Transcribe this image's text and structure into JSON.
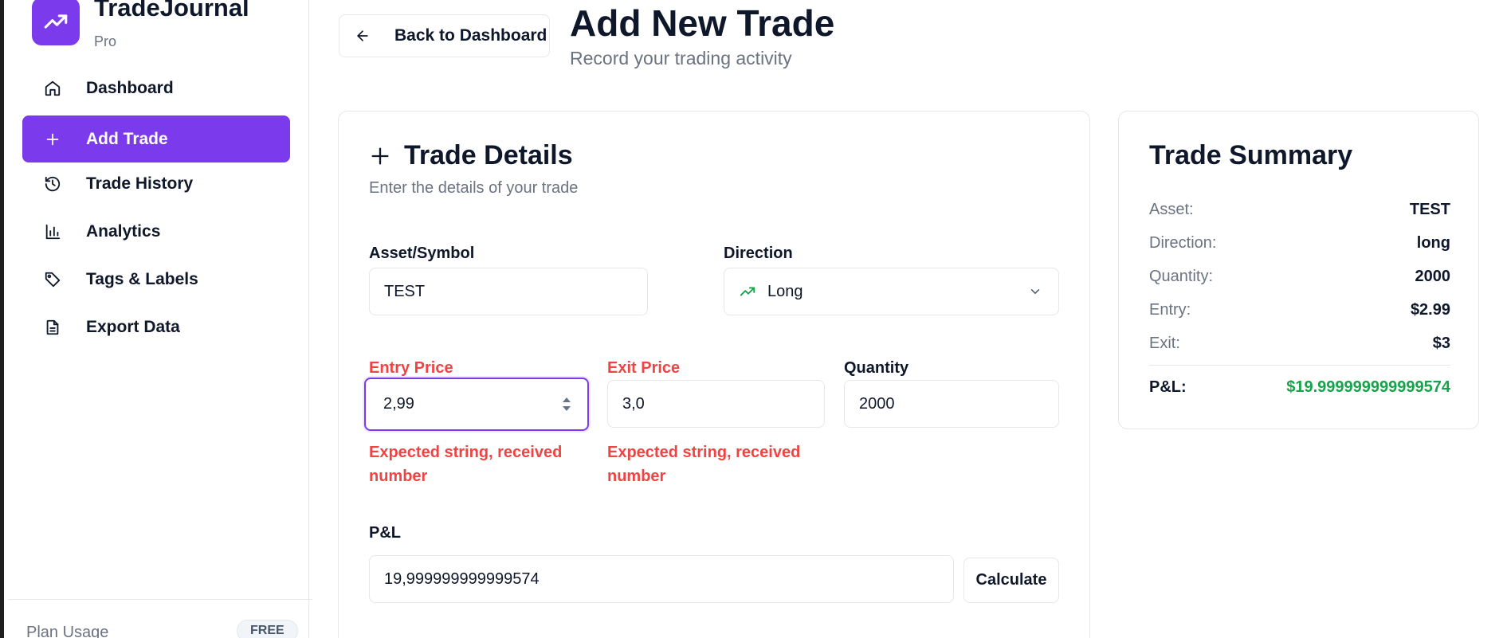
{
  "sidebar": {
    "brand_name": "TradeJournal",
    "brand_plan": "Pro",
    "items": [
      {
        "label": "Dashboard",
        "icon": "home-icon"
      },
      {
        "label": "Add Trade",
        "icon": "plus-icon"
      },
      {
        "label": "Trade History",
        "icon": "history-icon"
      },
      {
        "label": "Analytics",
        "icon": "bar-chart-icon"
      },
      {
        "label": "Tags & Labels",
        "icon": "tag-icon"
      },
      {
        "label": "Export Data",
        "icon": "file-icon"
      }
    ],
    "active_item": "Add Trade",
    "plan_usage_label": "Plan Usage",
    "plan_badge": "FREE"
  },
  "header": {
    "back_label": "Back to Dashboard",
    "title": "Add New Trade",
    "subtitle": "Record your trading activity"
  },
  "details": {
    "title": "Trade Details",
    "subtitle": "Enter the details of your trade",
    "asset_label": "Asset/Symbol",
    "asset_value": "TEST",
    "direction_label": "Direction",
    "direction_value": "Long",
    "entry_label": "Entry Price",
    "entry_value": "2,99",
    "entry_error": "Expected string, received number",
    "exit_label": "Exit Price",
    "exit_value": "3,0",
    "exit_error": "Expected string, received number",
    "quantity_label": "Quantity",
    "quantity_value": "2000",
    "pl_label": "P&L",
    "pl_value": "19,999999999999574",
    "calculate_label": "Calculate"
  },
  "summary": {
    "title": "Trade Summary",
    "asset_key": "Asset:",
    "asset_val": "TEST",
    "direction_key": "Direction:",
    "direction_val": "long",
    "quantity_key": "Quantity:",
    "quantity_val": "2000",
    "entry_key": "Entry:",
    "entry_val": "$2.99",
    "exit_key": "Exit:",
    "exit_val": "$3",
    "pl_key": "P&L:",
    "pl_val": "$19.999999999999574"
  },
  "colors": {
    "accent": "#7c3aed",
    "error": "#ef4444",
    "profit": "#16a34a",
    "muted": "#6b7280",
    "border": "#e5e7eb"
  }
}
